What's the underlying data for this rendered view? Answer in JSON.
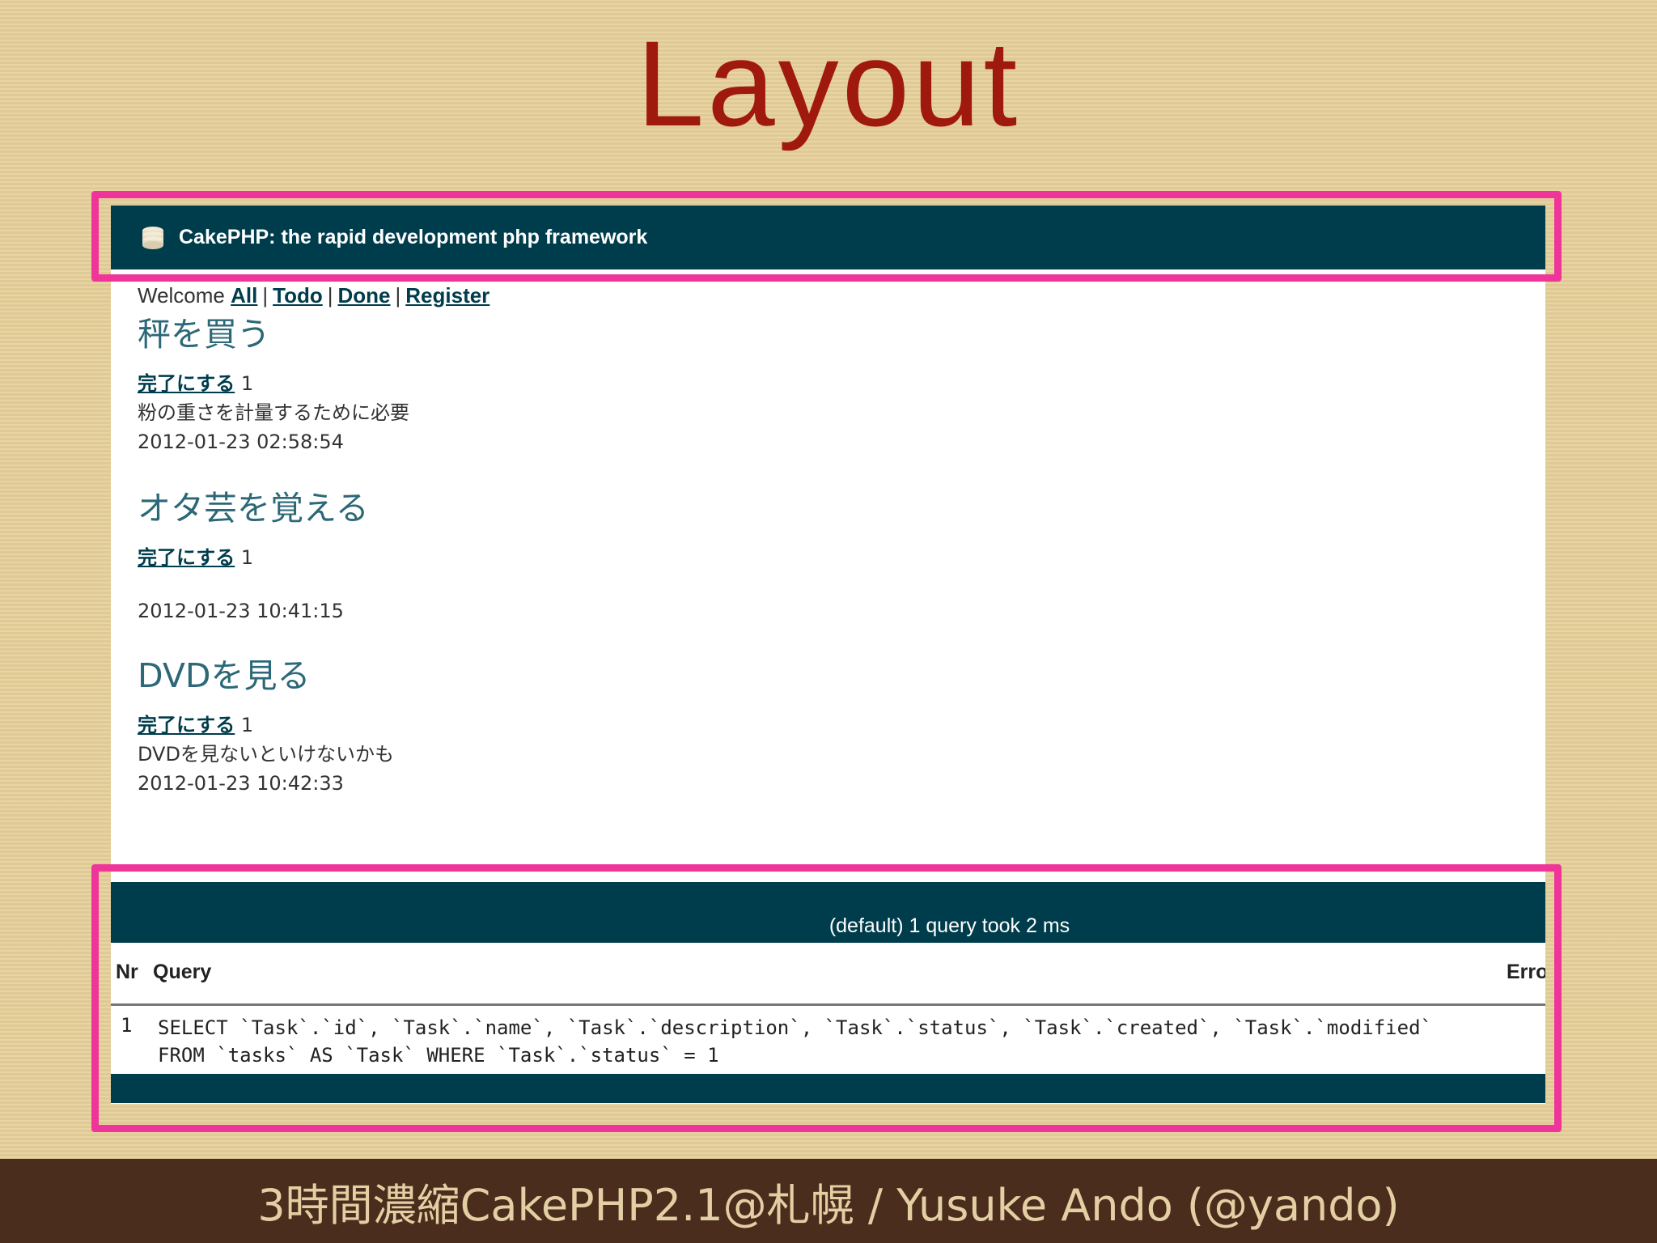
{
  "slide": {
    "title": "Layout",
    "footer": "3時間濃縮CakePHP2.1@札幌 / Yusuke Ando (@yando)"
  },
  "app": {
    "header_title": "CakePHP: the rapid development php framework",
    "nav": {
      "welcome": "Welcome",
      "links": [
        "All",
        "Todo",
        "Done",
        "Register"
      ]
    },
    "tasks": [
      {
        "name": "秤を買う",
        "action_label": "完了にする",
        "status": "1",
        "description": "粉の重さを計量するために必要",
        "created": "2012-01-23 02:58:54"
      },
      {
        "name": "オタ芸を覚える",
        "action_label": "完了にする",
        "status": "1",
        "description": "",
        "created": "2012-01-23 10:41:15"
      },
      {
        "name": "DVDを見る",
        "action_label": "完了にする",
        "status": "1",
        "description": "DVDを見ないといけないかも",
        "created": "2012-01-23 10:42:33"
      }
    ],
    "sql_log": {
      "summary": "(default) 1 query took 2 ms",
      "headers": {
        "nr": "Nr",
        "query": "Query",
        "error": "Error"
      },
      "rows": [
        {
          "nr": "1",
          "query": "SELECT `Task`.`id`, `Task`.`name`, `Task`.`description`, `Task`.`status`, `Task`.`created`, `Task`.`modified` FROM `tasks` AS `Task` WHERE `Task`.`status` = 1"
        }
      ]
    }
  },
  "colors": {
    "header_bg": "#003d4c",
    "highlight": "#f0359a",
    "title": "#a0190f",
    "task_title": "#2c6877"
  }
}
